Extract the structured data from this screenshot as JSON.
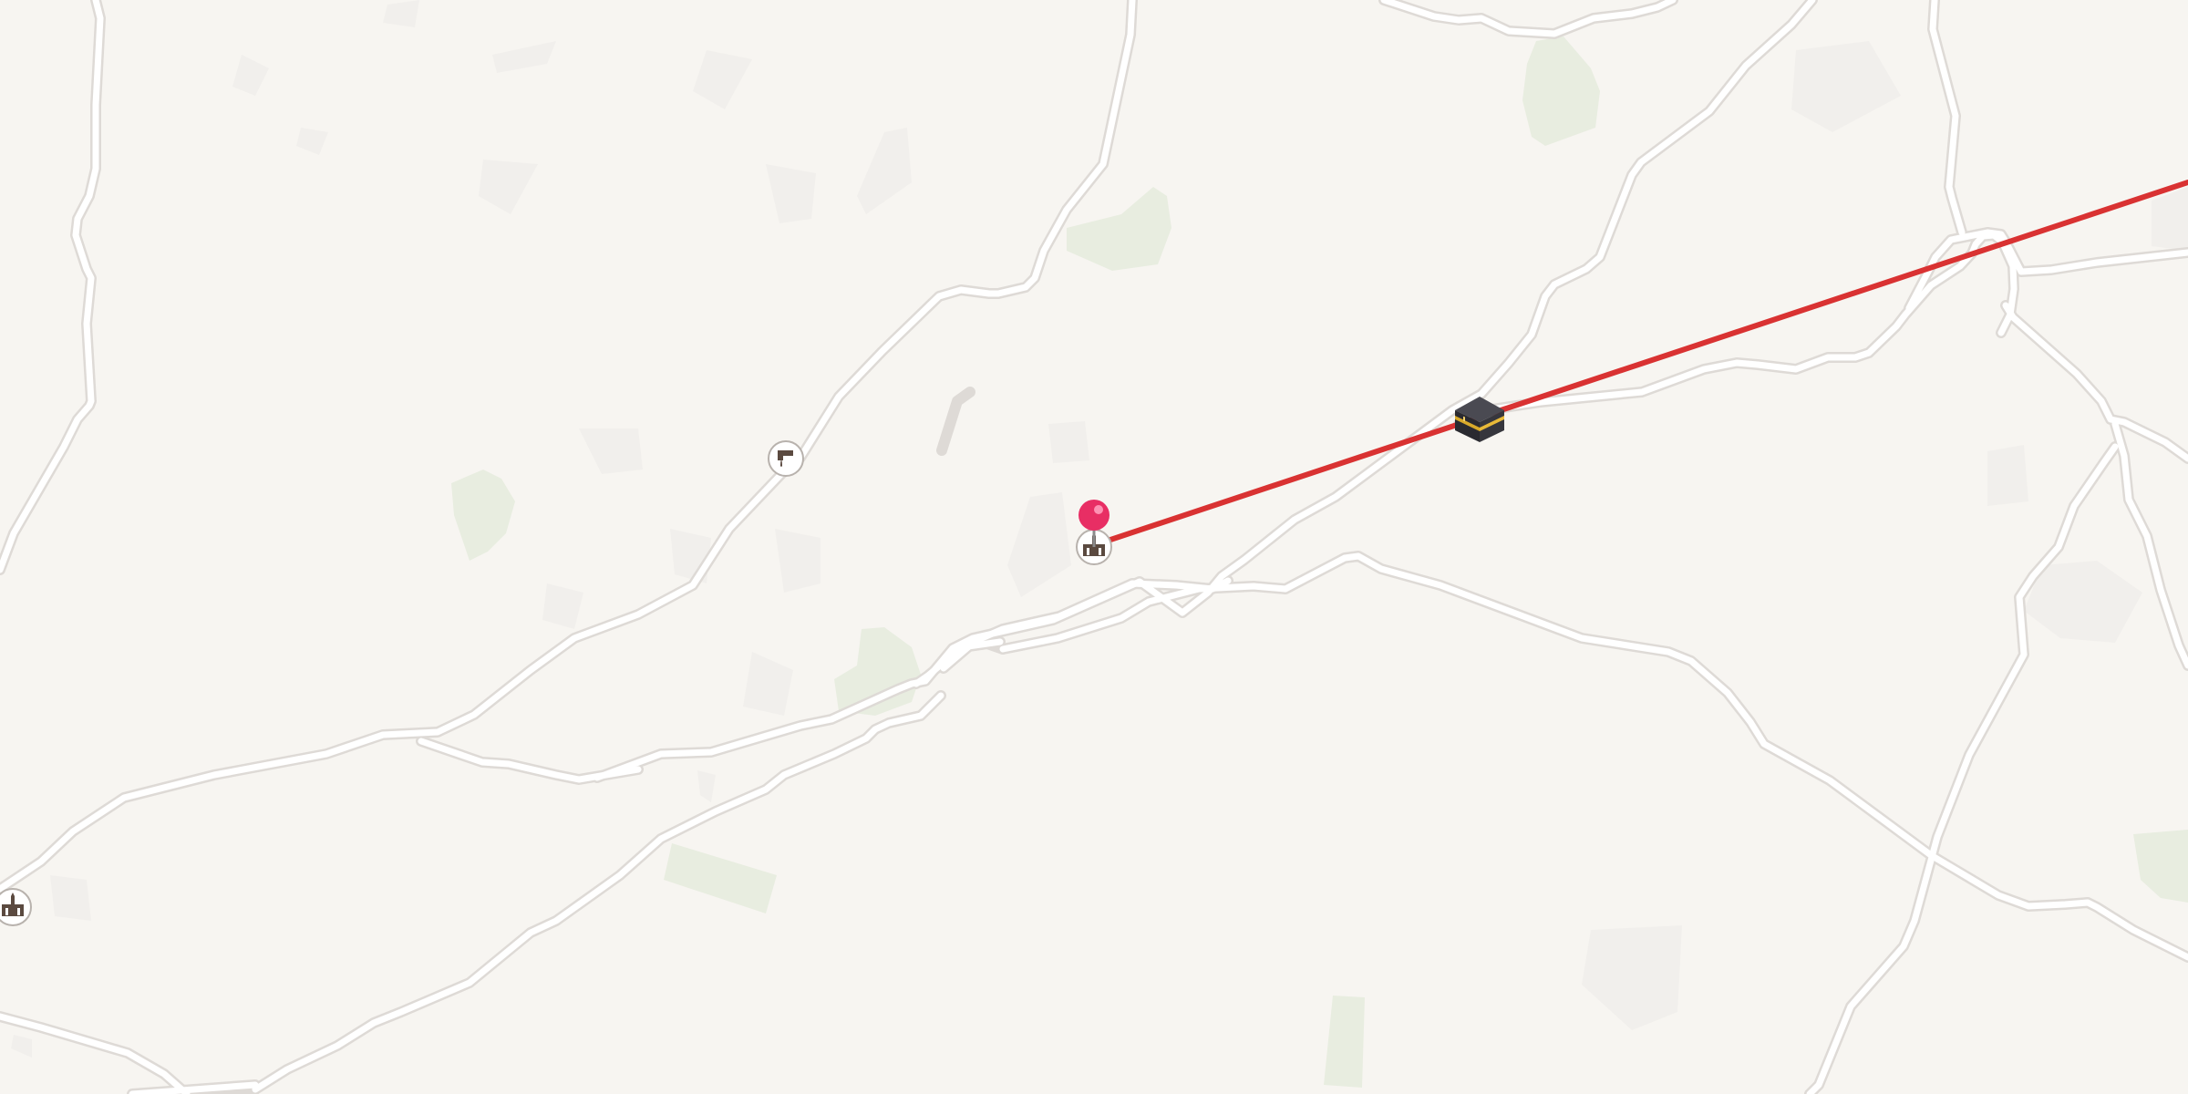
{
  "map": {
    "colors": {
      "background": "#f7f5f1",
      "road_fill": "#ffffff",
      "road_casing": "#dedad6",
      "green_area": "#e8ede0",
      "building_block": "#f1efec",
      "route_line": "#d93232",
      "pin": "#e82e64",
      "poi_icon": "#5b4a40"
    },
    "markers": {
      "selected_pin": {
        "icon": "map-pin-icon",
        "color": "#e82e64"
      },
      "kaaba": {
        "icon": "kaaba-icon"
      },
      "poi_mosque_center": {
        "icon": "mosque-icon"
      },
      "poi_mosque_left": {
        "icon": "mosque-icon"
      },
      "poi_water_tap": {
        "icon": "water-tap-icon"
      }
    },
    "route": {
      "icon": "direction-line"
    }
  }
}
